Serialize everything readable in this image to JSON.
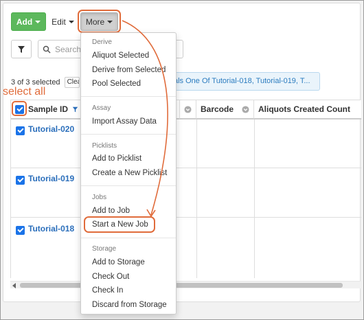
{
  "toolbar": {
    "add_label": "Add",
    "edit_label": "Edit",
    "more_label": "More",
    "search_placeholder": "Search..."
  },
  "selection": {
    "status_text": "3 of 3 selected",
    "clear_label": "Clear"
  },
  "filter_chip_text": "als One Of Tutorial-018, Tutorial-019, T...",
  "annotation": {
    "select_all": "select all",
    "color": "#e06b3a"
  },
  "grid": {
    "columns": [
      "Sample ID",
      "Barcode",
      "Aliquots Created Count"
    ],
    "rows": [
      {
        "sample_id": "Tutorial-020"
      },
      {
        "sample_id": "Tutorial-019"
      },
      {
        "sample_id": "Tutorial-018"
      }
    ]
  },
  "menu": {
    "derive_header": "Derive",
    "derive_items": [
      "Aliquot Selected",
      "Derive from Selected",
      "Pool Selected"
    ],
    "assay_header": "Assay",
    "assay_items": [
      "Import Assay Data"
    ],
    "picklists_header": "Picklists",
    "picklists_items": [
      "Add to Picklist",
      "Create a New Picklist"
    ],
    "jobs_header": "Jobs",
    "jobs_items": [
      "Add to Job",
      "Start a New Job"
    ],
    "storage_header": "Storage",
    "storage_items": [
      "Add to Storage",
      "Check Out",
      "Check In",
      "Discard from Storage"
    ]
  },
  "colors": {
    "add_button": "#5cb85c",
    "link": "#2a6ebb",
    "checkbox": "#1a73e8"
  },
  "icons": [
    "filter-icon",
    "search-icon",
    "caret-down-icon",
    "column-menu-icon",
    "checkbox-icon"
  ]
}
